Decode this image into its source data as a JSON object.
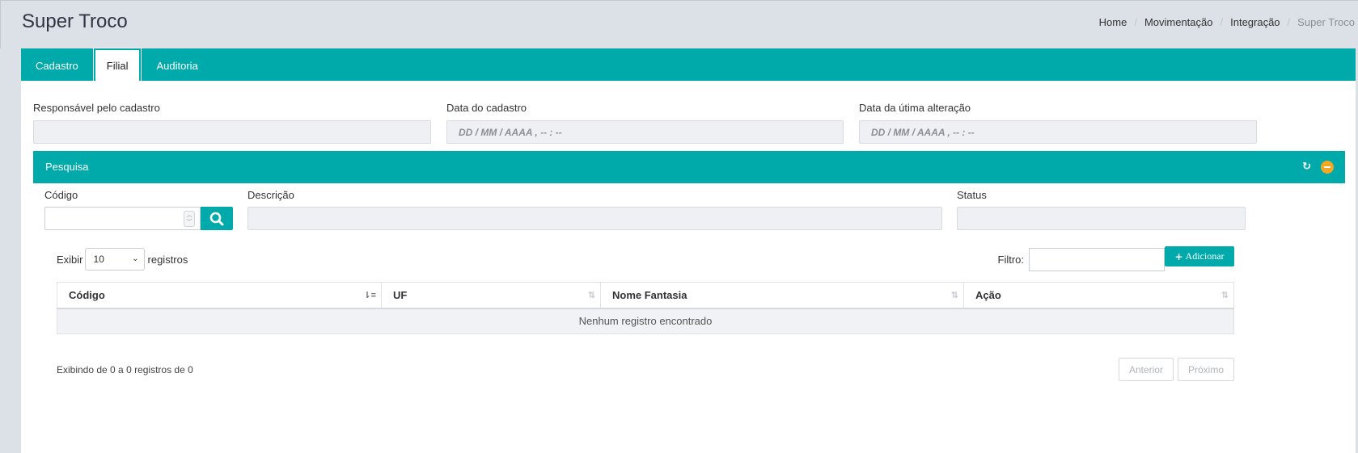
{
  "header": {
    "title": "Super Troco",
    "breadcrumb": [
      "Home",
      "Movimentação",
      "Integração",
      "Super Troco"
    ]
  },
  "tabs": [
    "Cadastro",
    "Filial",
    "Auditoria"
  ],
  "active_tab": "Filial",
  "cadastro": {
    "responsavel_label": "Responsável pelo cadastro",
    "responsavel_value": "",
    "data_cadastro_label": "Data do cadastro",
    "data_cadastro_value": "DD / MM / AAAA ,  -- : --",
    "data_alteracao_label": "Data da útima alteração",
    "data_alteracao_value": "DD / MM / AAAA ,  -- : --"
  },
  "pesquisa": {
    "title": "Pesquisa",
    "codigo_label": "Código",
    "codigo_value": "",
    "descricao_label": "Descrição",
    "descricao_value": "",
    "status_label": "Status",
    "status_value": ""
  },
  "table": {
    "show_label": "Exibir",
    "show_value": "10",
    "records_label": "registros",
    "filter_label": "Filtro:",
    "filter_value": "",
    "add_button": "Adicionar",
    "columns": [
      "Código",
      "UF",
      "Nome Fantasia",
      "Ação"
    ],
    "empty_message": "Nenhum registro encontrado",
    "info": "Exibindo de 0 a 0 registros de 0",
    "prev": "Anterior",
    "next": "Próximo"
  },
  "colors": {
    "accent": "#00aaaa",
    "warning": "#f5a623"
  },
  "icons": [
    "refresh-icon",
    "collapse-icon",
    "search-icon",
    "plus-icon",
    "sort-icon",
    "chevron-down-icon"
  ]
}
